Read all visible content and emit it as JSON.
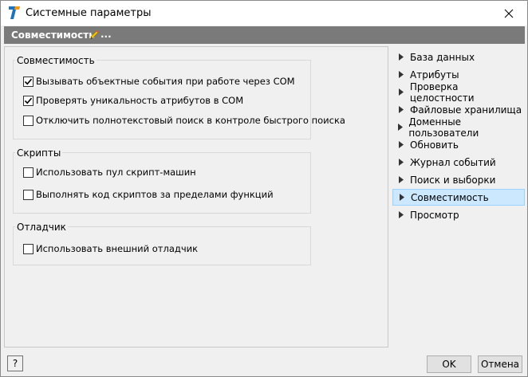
{
  "window": {
    "title": "Системные параметры"
  },
  "header": {
    "title": "Совместимость",
    "suffix": "..."
  },
  "groups": {
    "compat": {
      "title": "Совместимость",
      "items": [
        {
          "label": "Вызывать объектные события при работе через COM",
          "checked": true
        },
        {
          "label": "Проверять уникальность атрибутов в COM",
          "checked": true
        },
        {
          "label": "Отключить полнотекстовый поиск в контроле быстрого поиска",
          "checked": false
        }
      ]
    },
    "scripts": {
      "title": "Скрипты",
      "items": [
        {
          "label": "Использовать пул скрипт-машин",
          "checked": false
        },
        {
          "label": "Выполнять код скриптов за пределами функций",
          "checked": false
        }
      ]
    },
    "debugger": {
      "title": "Отладчик",
      "items": [
        {
          "label": "Использовать внешний отладчик",
          "checked": false
        }
      ]
    }
  },
  "tree": {
    "items": [
      "База данных",
      "Атрибуты",
      "Проверка целостности",
      "Файловые хранилища",
      "Доменные пользователи",
      "Обновить",
      "Журнал событий",
      "Поиск и выборки",
      "Совместимость",
      "Просмотр"
    ],
    "selected": "Совместимость"
  },
  "buttons": {
    "help": "?",
    "ok": "OK",
    "cancel": "Отмена"
  },
  "colors": {
    "header_bg": "#7a7a7a",
    "selection_bg": "#cce8ff",
    "icon_blue": "#1e73be",
    "icon_orange": "#f39c12"
  }
}
